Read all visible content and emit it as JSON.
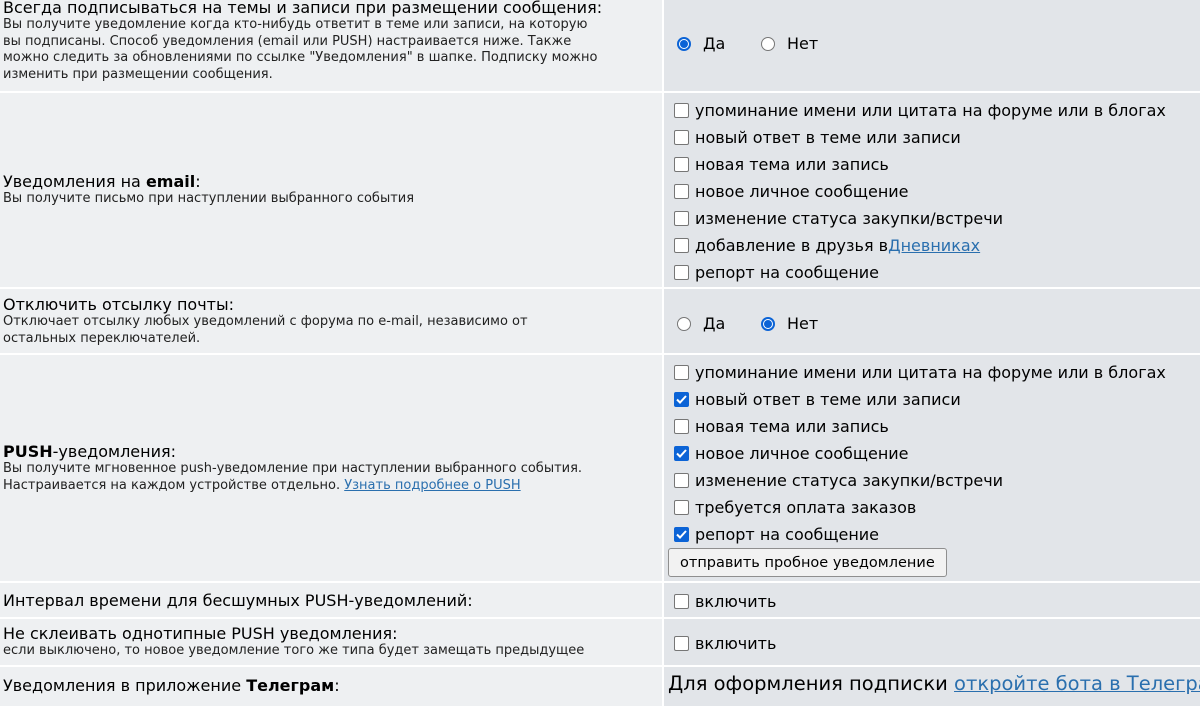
{
  "radio_true": "Да",
  "radio_false": "Нет",
  "enable_label": "включить",
  "subscribe": {
    "title": "Всегда подписываться на темы и записи при размещении сообщения:",
    "desc": [
      "Вы получите уведомление когда кто-нибудь ответит в теме или записи, на которую",
      "вы подписаны. Способ уведомления (email или PUSH) настраивается ниже. Также",
      "можно следить за обновлениями по ссылке \"Уведомления\" в шапке. Подписку можно",
      "изменить при размещении сообщения."
    ],
    "selected": "yes"
  },
  "email": {
    "title_prefix": "Уведомления на ",
    "title_bold": "email",
    "title_suffix": ":",
    "desc": "Вы получите письмо при наступлении выбранного события",
    "options": [
      {
        "label": "упоминание имени или цитата на форуме или в блогах",
        "checked": false
      },
      {
        "label": "новый ответ в теме или записи",
        "checked": false
      },
      {
        "label": "новая тема или запись",
        "checked": false
      },
      {
        "label": "новое личное сообщение",
        "checked": false
      },
      {
        "label": "изменение статуса закупки/встречи",
        "checked": false
      },
      {
        "label": "добавление в друзья в ",
        "link": "Дневниках",
        "checked": false
      },
      {
        "label": "репорт на сообщение",
        "checked": false
      }
    ]
  },
  "disable_mail": {
    "title": "Отключить отсылку почты:",
    "desc": [
      "Отключает отсылку любых уведомлений с форума по e-mail, независимо от",
      "остальных переключателей."
    ],
    "selected": "no"
  },
  "push": {
    "title_bold": "PUSH",
    "title_suffix": "-уведомления:",
    "desc_line1": "Вы получите мгновенное push-уведомление при наступлении выбранного события.",
    "desc_line2": "Настраивается на каждом устройстве отдельно. ",
    "desc_link": "Узнать подробнее о PUSH",
    "options": [
      {
        "label": "упоминание имени или цитата на форуме или в блогах",
        "checked": false
      },
      {
        "label": "новый ответ в теме или записи",
        "checked": true
      },
      {
        "label": "новая тема или запись",
        "checked": false
      },
      {
        "label": "новое личное сообщение",
        "checked": true
      },
      {
        "label": "изменение статуса закупки/встречи",
        "checked": false
      },
      {
        "label": "требуется оплата заказов",
        "checked": false
      },
      {
        "label": "репорт на сообщение",
        "checked": true
      }
    ],
    "test_button": "отправить пробное уведомление"
  },
  "silent": {
    "title": "Интервал времени для бесшумных PUSH-уведомлений:",
    "checked": false
  },
  "no_merge": {
    "title": "Не склеивать однотипные PUSH уведомления:",
    "desc": "если выключено, то новое уведомление того же типа будет замещать предыдущее",
    "checked": false
  },
  "telegram": {
    "title_prefix": "Уведомления в приложение ",
    "title_bold": "Телеграм",
    "title_suffix": ":",
    "text": "Для оформления подписки ",
    "link": "откройте бота в Телеграм"
  }
}
